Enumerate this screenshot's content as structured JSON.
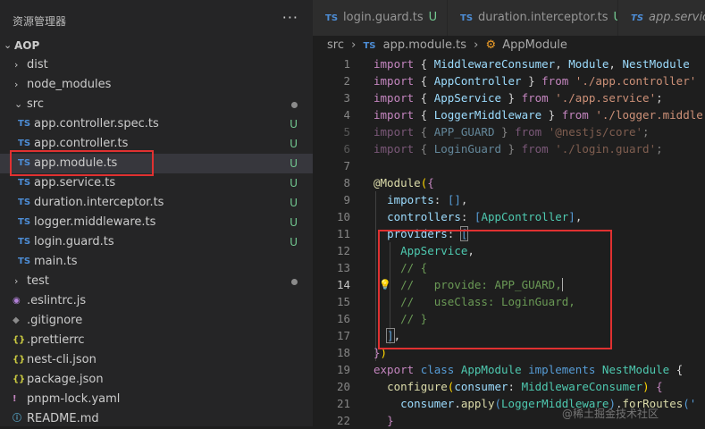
{
  "explorer": {
    "title": "资源管理器",
    "more": "···",
    "project": "AOP",
    "items": [
      {
        "label": "dist",
        "kind": "folder",
        "expanded": false,
        "status": ""
      },
      {
        "label": "node_modules",
        "kind": "folder",
        "expanded": false,
        "status": ""
      },
      {
        "label": "src",
        "kind": "folder",
        "expanded": true,
        "status": "dot"
      },
      {
        "label": "app.controller.spec.ts",
        "kind": "ts",
        "status": "U"
      },
      {
        "label": "app.controller.ts",
        "kind": "ts",
        "status": "U"
      },
      {
        "label": "app.module.ts",
        "kind": "ts",
        "status": "U",
        "selected": true
      },
      {
        "label": "app.service.ts",
        "kind": "ts",
        "status": "U"
      },
      {
        "label": "duration.interceptor.ts",
        "kind": "ts",
        "status": "U"
      },
      {
        "label": "logger.middleware.ts",
        "kind": "ts",
        "status": "U"
      },
      {
        "label": "login.guard.ts",
        "kind": "ts",
        "status": "U"
      },
      {
        "label": "main.ts",
        "kind": "ts",
        "status": ""
      },
      {
        "label": "test",
        "kind": "folder",
        "expanded": false,
        "status": "dot"
      },
      {
        "label": ".eslintrc.js",
        "kind": "js",
        "status": ""
      },
      {
        "label": ".gitignore",
        "kind": "git",
        "status": ""
      },
      {
        "label": ".prettierrc",
        "kind": "json",
        "status": ""
      },
      {
        "label": "nest-cli.json",
        "kind": "json",
        "status": ""
      },
      {
        "label": "package.json",
        "kind": "json",
        "status": ""
      },
      {
        "label": "pnpm-lock.yaml",
        "kind": "yaml",
        "status": ""
      },
      {
        "label": "README.md",
        "kind": "md",
        "status": ""
      }
    ]
  },
  "icons": {
    "ts": "TS",
    "js": "◉",
    "git": "◆",
    "json": "{}",
    "yaml": "!",
    "md": "ⓘ",
    "chevron_right": "›",
    "chevron_down": "⌄"
  },
  "tabs": [
    {
      "label": "login.guard.ts",
      "status": "U"
    },
    {
      "label": "duration.interceptor.ts",
      "status": "U"
    },
    {
      "label": "app.service.ts",
      "status": ""
    }
  ],
  "breadcrumb": {
    "folder": "src",
    "file": "app.module.ts",
    "symbol": "AppModule",
    "sep": "›"
  },
  "code": {
    "line_numbers": [
      "1",
      "2",
      "3",
      "4",
      "5",
      "6",
      "7",
      "8",
      "9",
      "10",
      "11",
      "12",
      "13",
      "14",
      "15",
      "16",
      "17",
      "18",
      "19",
      "20",
      "21",
      "22"
    ],
    "active_line": "14"
  },
  "watermark": "@稀土掘金技术社区",
  "colors": {
    "accent_red": "#e03131",
    "untracked": "#73c991",
    "selected_bg": "#37373d"
  }
}
